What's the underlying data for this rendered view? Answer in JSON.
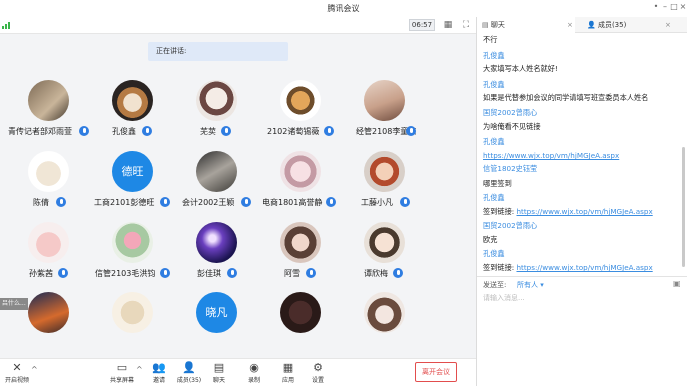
{
  "window": {
    "title": "腾讯会议"
  },
  "top_toolbar": {
    "timer": "06:57"
  },
  "video": {
    "speaking_label": "正在讲话:",
    "participants": [
      {
        "name": "青传记者部邓雨萱"
      },
      {
        "name": "孔俊鑫"
      },
      {
        "name": "芜荬"
      },
      {
        "name": "2102诸萄锡薇"
      },
      {
        "name": "经管2108李童茹"
      },
      {
        "name": "陈倩"
      },
      {
        "name": "工商2101彭德旺",
        "avatar_text": "德旺"
      },
      {
        "name": "会计2002王颖"
      },
      {
        "name": "电商1801高誉静"
      },
      {
        "name": "工藤小凡"
      },
      {
        "name": "孙紫茜"
      },
      {
        "name": "信管2103毛洪钧"
      },
      {
        "name": "彭佳琪"
      },
      {
        "name": "阿雪"
      },
      {
        "name": "谭欣梅"
      },
      {
        "name": "",
        "avatar_text": "晓凡"
      }
    ],
    "side_tab": "吕什么..."
  },
  "bottom_toolbar": {
    "video": "开启视频",
    "share": "共享屏幕",
    "invite": "邀请",
    "members": "成员(35)",
    "chat": "聊天",
    "record": "录制",
    "apps": "应用",
    "settings": "设置",
    "leave": "离开会议"
  },
  "chat_panel": {
    "tab_chat": "聊天",
    "tab_members": "成员(35)",
    "messages": [
      {
        "type": "text",
        "content": "不行"
      },
      {
        "type": "sender",
        "content": "孔俊鑫"
      },
      {
        "type": "text",
        "content": "大家填写本人姓名就好!"
      },
      {
        "type": "sender",
        "content": "孔俊鑫"
      },
      {
        "type": "text",
        "content": "如果是代替参加会议的同学请填写班宣委员本人姓名"
      },
      {
        "type": "sender",
        "content": "国贸2002曾雨心"
      },
      {
        "type": "text",
        "content": "为啥俺看不见链接"
      },
      {
        "type": "sender",
        "content": "孔俊鑫"
      },
      {
        "type": "link",
        "content": "https://www.wjx.top/vm/hjMGJeA.aspx"
      },
      {
        "type": "sender",
        "content": "信管1802史钰莹"
      },
      {
        "type": "text",
        "content": "哪里签到"
      },
      {
        "type": "sender",
        "content": "孔俊鑫"
      },
      {
        "type": "labeled_link",
        "label": "签到链接:",
        "content": "https://www.wjx.top/vm/hjMGJeA.aspx"
      },
      {
        "type": "sender",
        "content": "国贸2002曾雨心"
      },
      {
        "type": "text",
        "content": "欧克"
      },
      {
        "type": "sender",
        "content": "孔俊鑫"
      },
      {
        "type": "labeled_link",
        "label": "签到链接:",
        "content": "https://www.wjx.top/vm/hjMGJeA.aspx"
      }
    ],
    "send_to_label": "发送至:",
    "send_to_value": "所有人",
    "input_placeholder": "请输入消息..."
  }
}
